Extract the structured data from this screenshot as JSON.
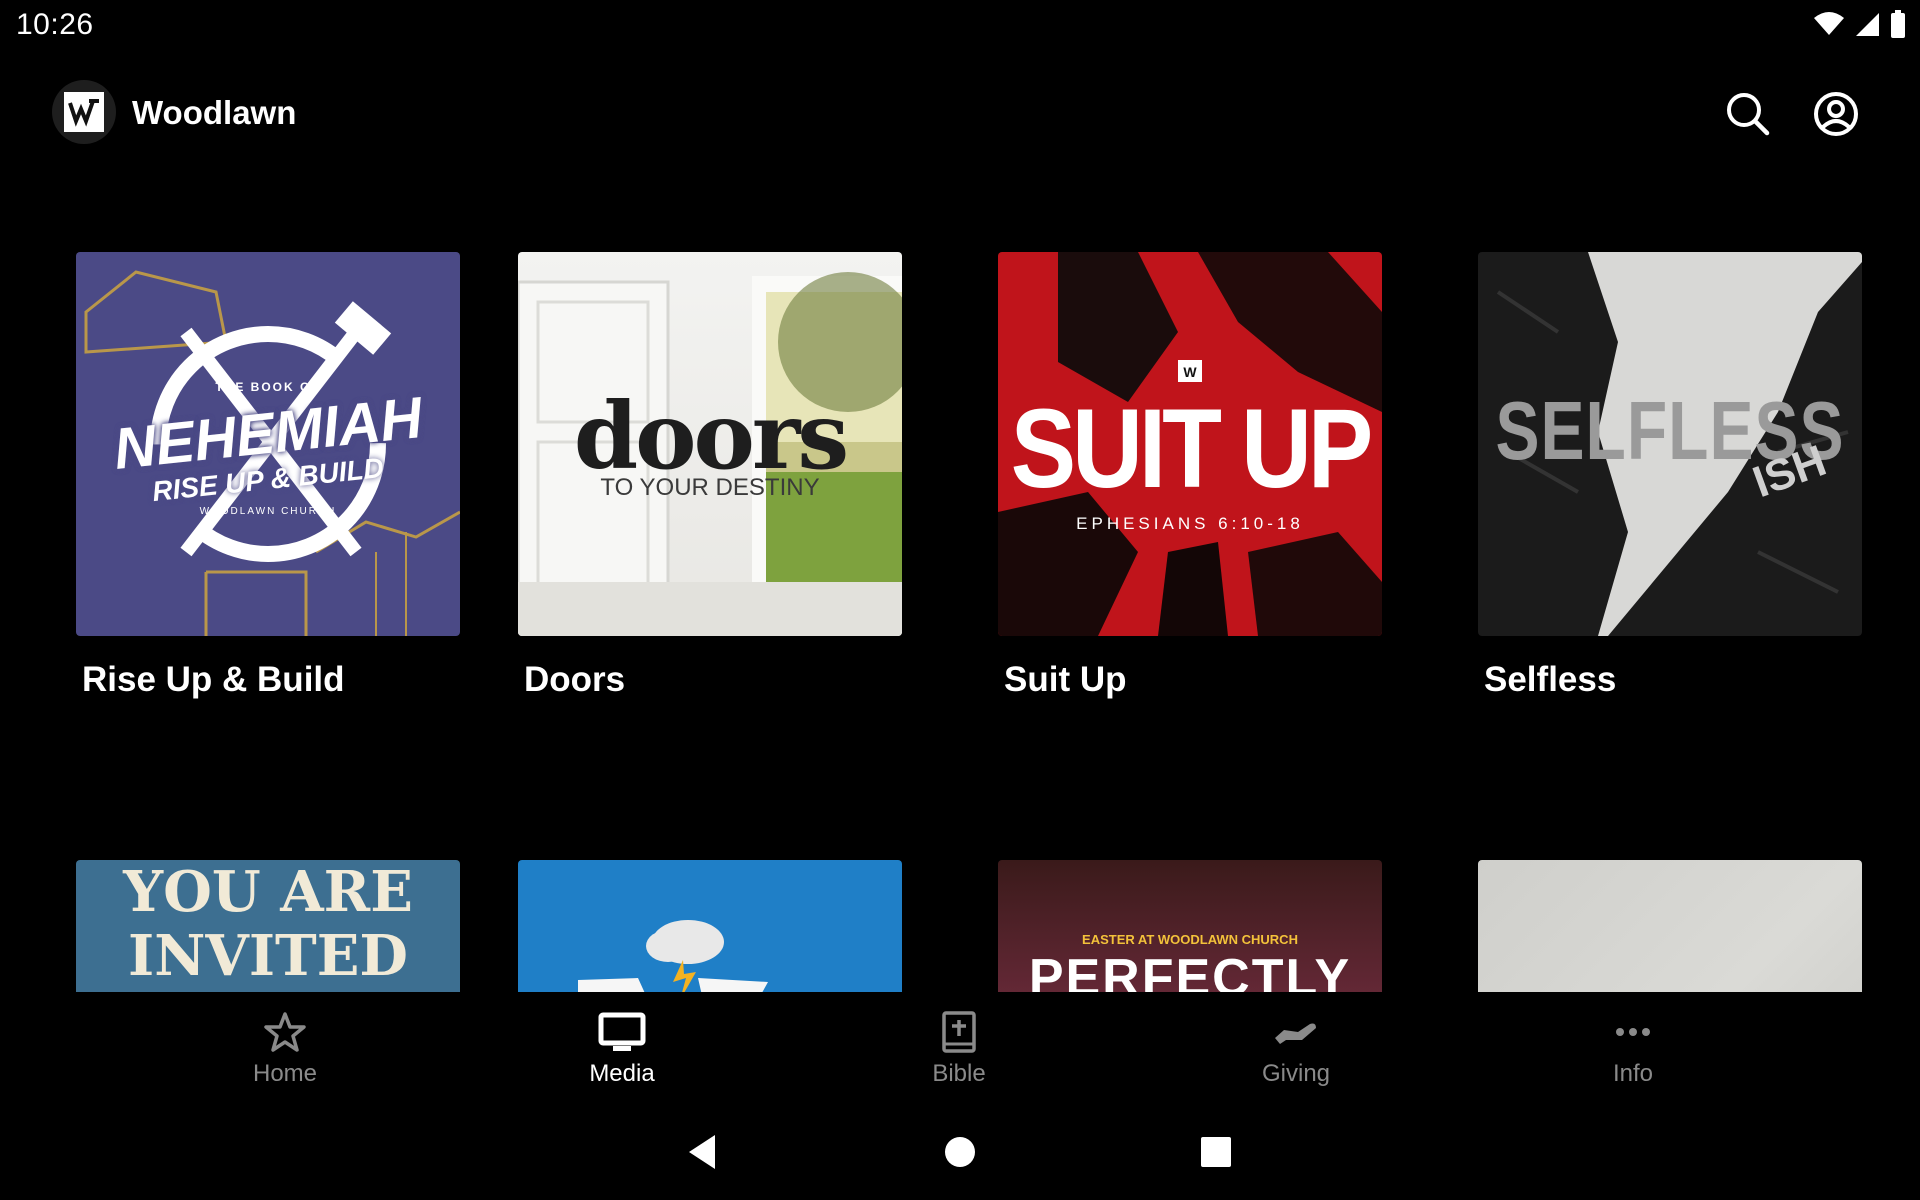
{
  "status_bar": {
    "time": "10:26"
  },
  "app_bar": {
    "title": "Woodlawn",
    "logo_letter": "W"
  },
  "series": [
    {
      "title": "Rise Up & Build",
      "art": {
        "top": "THE BOOK OF",
        "main": "NEHEMIAH",
        "sub": "RISE UP & BUILD",
        "small": "WOODLAWN CHURCH"
      }
    },
    {
      "title": "Doors",
      "art": {
        "main": "doors",
        "sub": "TO YOUR DESTINY"
      }
    },
    {
      "title": "Suit Up",
      "art": {
        "main": "SUIT UP",
        "sub": "EPHESIANS 6:10-18"
      }
    },
    {
      "title": "Selfless",
      "art": {
        "main": "SELFLESS",
        "sub": "ISH"
      }
    }
  ],
  "series_row2": [
    {
      "art": {
        "line1": "YOU ARE",
        "line2": "INVITED"
      }
    },
    {
      "art": {}
    },
    {
      "art": {
        "small": "EASTER AT WOODLAWN CHURCH",
        "main": "PERFECTLY"
      }
    },
    {
      "art": {}
    }
  ],
  "bottom_nav": [
    {
      "label": "Home",
      "icon": "star-icon",
      "active": false
    },
    {
      "label": "Media",
      "icon": "tv-icon",
      "active": true
    },
    {
      "label": "Bible",
      "icon": "bible-icon",
      "active": false
    },
    {
      "label": "Giving",
      "icon": "giving-icon",
      "active": false
    },
    {
      "label": "Info",
      "icon": "more-icon",
      "active": false
    }
  ],
  "colors": {
    "background": "#000000",
    "active_nav": "#ffffff",
    "inactive_nav": "#8a8a8a",
    "nehemiah_bg": "#4b4a86",
    "suitup_red": "#c0141b",
    "invited_bg": "#3d6f91",
    "blue_bg": "#1f7fc7"
  }
}
